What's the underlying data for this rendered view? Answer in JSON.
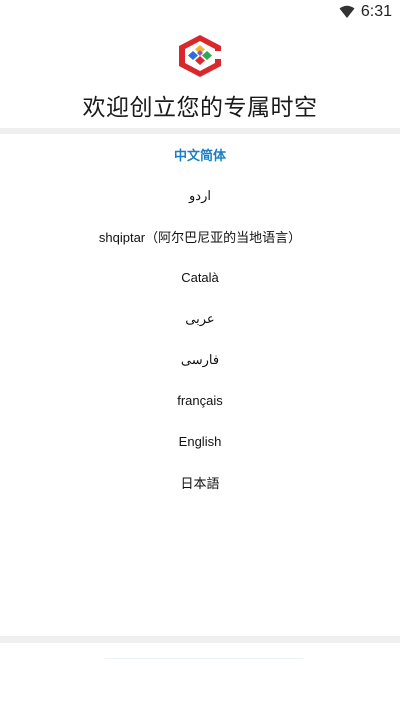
{
  "status_bar": {
    "time": "6:31",
    "icons": [
      "wifi-icon"
    ]
  },
  "header": {
    "logo": "app-logo",
    "title": "欢迎创立您的专属时空"
  },
  "languages": [
    {
      "label": "中文简体",
      "selected": true
    },
    {
      "label": "اردو",
      "selected": false
    },
    {
      "label": "shqiptar（阿尔巴尼亚的当地语言）",
      "selected": false
    },
    {
      "label": "Català",
      "selected": false
    },
    {
      "label": "عربى",
      "selected": false
    },
    {
      "label": "فارسی",
      "selected": false
    },
    {
      "label": "français",
      "selected": false
    },
    {
      "label": "English",
      "selected": false
    },
    {
      "label": "日本語",
      "selected": false
    }
  ],
  "colors": {
    "selected_text": "#1a7fc4",
    "divider": "#efefef",
    "logo_red": "#d8282c",
    "logo_blue": "#2a6fd6",
    "logo_green": "#2fa84f",
    "logo_yellow": "#f2b91e"
  }
}
